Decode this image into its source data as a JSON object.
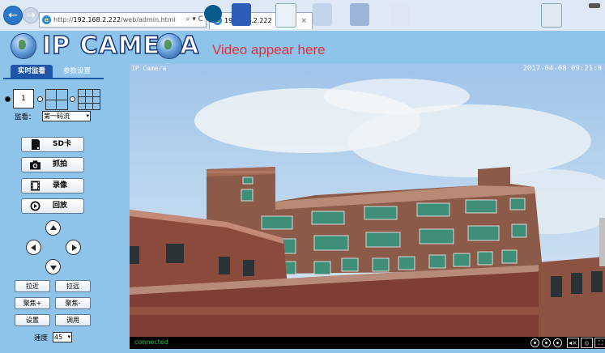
{
  "browser": {
    "url_prefix": "http://",
    "url_host": "192.168.2.222",
    "url_path": "/web/admin.html",
    "url_tools": "⌕ ▾ C",
    "tab_title": "192.168.2.222",
    "tab_close": "×",
    "back": "←",
    "forward": "→",
    "ie_glyph": "e"
  },
  "header": {
    "title": "IP CAMERA",
    "video_hint": "Video appear here"
  },
  "sidebar": {
    "tabs": [
      "实时监看",
      "参数设置"
    ],
    "layout_single_label": "1",
    "stream_label": "监看：",
    "stream_value": "第一码流",
    "buttons": [
      "SD卡",
      "抓拍",
      "录像",
      "回放"
    ],
    "ptz_small_buttons": [
      "拉近",
      "拉远",
      "聚焦+",
      "聚焦-",
      "设置",
      "调用"
    ],
    "speed_label": "速度",
    "speed_value": "45",
    "dropdown_arrow": "▾"
  },
  "video": {
    "osd_name": "IP Camera",
    "osd_time": "2017-04-08 09:21:0",
    "status": "connected",
    "sq_icons": [
      "◂×",
      "⦸",
      "⛶"
    ]
  },
  "colors": {
    "page_bg": "#8ec3ea",
    "tab_active": "#1e55a8",
    "title_outline": "#1a3a78",
    "hint_red": "#e0313a",
    "status_green": "#2ec24e"
  }
}
